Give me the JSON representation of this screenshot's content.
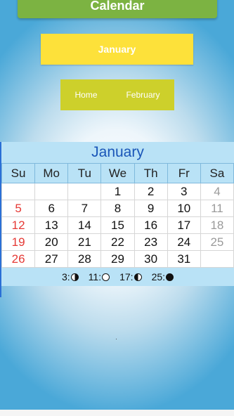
{
  "app": {
    "title": "Calendar"
  },
  "month_button": {
    "label": "January"
  },
  "nav": {
    "home_label": "Home",
    "next_label": "February"
  },
  "calendar": {
    "month": "January",
    "weekdays": [
      "Su",
      "Mo",
      "Tu",
      "We",
      "Th",
      "Fr",
      "Sa"
    ],
    "weeks": [
      [
        "",
        "",
        "",
        "1",
        "2",
        "3",
        "4"
      ],
      [
        "5",
        "6",
        "7",
        "8",
        "9",
        "10",
        "11"
      ],
      [
        "12",
        "13",
        "14",
        "15",
        "16",
        "17",
        "18"
      ],
      [
        "19",
        "20",
        "21",
        "22",
        "23",
        "24",
        "25"
      ],
      [
        "26",
        "27",
        "28",
        "29",
        "30",
        "31",
        ""
      ]
    ],
    "moon_phases": [
      {
        "day": "3:",
        "phase": "first-quarter-moon-icon"
      },
      {
        "day": "11:",
        "phase": "full-moon-icon"
      },
      {
        "day": "17:",
        "phase": "last-quarter-moon-icon"
      },
      {
        "day": "25:",
        "phase": "new-moon-icon"
      }
    ]
  },
  "colors": {
    "title_bar": "#7cb342",
    "month_button": "#fde13a",
    "nav_box": "#cdd02b",
    "sunday": "#e53935",
    "saturday": "#9a9a9a",
    "header": "#b9e2f6"
  }
}
